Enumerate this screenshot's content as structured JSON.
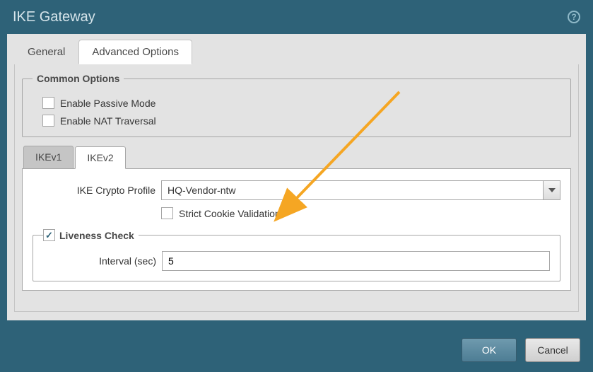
{
  "title": "IKE Gateway",
  "outerTabs": {
    "general": "General",
    "advanced": "Advanced Options"
  },
  "common": {
    "legend": "Common Options",
    "passive": "Enable Passive Mode",
    "nat": "Enable NAT Traversal"
  },
  "innerTabs": {
    "ikev1": "IKEv1",
    "ikev2": "IKEv2"
  },
  "ikev2": {
    "cryptoLabel": "IKE Crypto Profile",
    "cryptoValue": "HQ-Vendor-ntw",
    "strict": "Strict Cookie Validation"
  },
  "liveness": {
    "legend": "Liveness Check",
    "intervalLabel": "Interval (sec)",
    "intervalValue": "5"
  },
  "buttons": {
    "ok": "OK",
    "cancel": "Cancel"
  }
}
